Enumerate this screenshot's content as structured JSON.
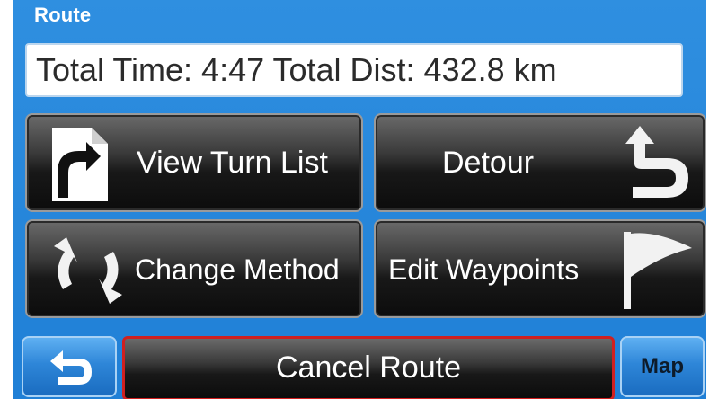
{
  "screen": {
    "title": "Route"
  },
  "summary": {
    "text": "Total Time: 4:47  Total Dist: 432.8 km"
  },
  "buttons": {
    "turn_list": "View Turn List",
    "detour": "Detour",
    "change_method": "Change Method",
    "edit_waypoints": "Edit Waypoints"
  },
  "footer": {
    "cancel": "Cancel Route",
    "map": "Map"
  },
  "icons": {
    "turn_list": "turn-list-document-icon",
    "detour": "detour-arrow-icon",
    "change_method": "circular-arrows-icon",
    "edit_waypoints": "flag-icon",
    "back": "back-arrow-icon"
  },
  "colors": {
    "background": "#1f7fd6",
    "cancel_border": "#d02020",
    "button_dark": "#181818"
  }
}
